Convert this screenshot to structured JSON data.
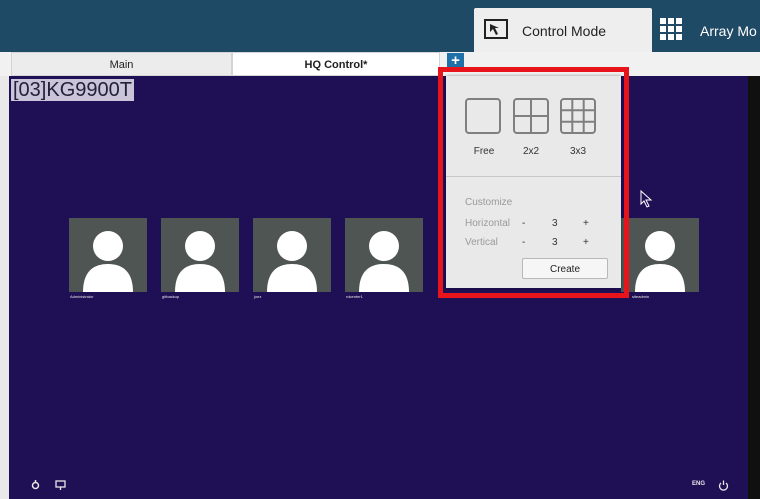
{
  "header": {
    "control_mode_label": "Control Mode",
    "array_mode_label": "Array Mo"
  },
  "tabs": [
    {
      "label": "Main"
    },
    {
      "label": "HQ Control*"
    }
  ],
  "add_tab_label": "+",
  "device_label": "[03]KG9900T",
  "users": [
    {
      "name": "Administrator"
    },
    {
      "name": "gitbackup"
    },
    {
      "name": "joez"
    },
    {
      "name": "rdcenter1"
    },
    {
      "name": "siteadmin"
    }
  ],
  "layout_popup": {
    "options": [
      {
        "label": "Free",
        "icon": "free-layout-icon"
      },
      {
        "label": "2x2",
        "icon": "grid-2x2-icon"
      },
      {
        "label": "3x3",
        "icon": "grid-3x3-icon"
      }
    ],
    "customize": {
      "title": "Customize",
      "horizontal": {
        "label": "Horizontal",
        "minus": "-",
        "value": "3",
        "plus": "+"
      },
      "vertical": {
        "label": "Vertical",
        "minus": "-",
        "value": "3",
        "plus": "+"
      }
    },
    "create_label": "Create"
  },
  "footer": {
    "language": "ENG"
  },
  "colors": {
    "workspace": "#1f0f55",
    "topbar": "#1f4a66",
    "highlight": "#e8141b"
  }
}
